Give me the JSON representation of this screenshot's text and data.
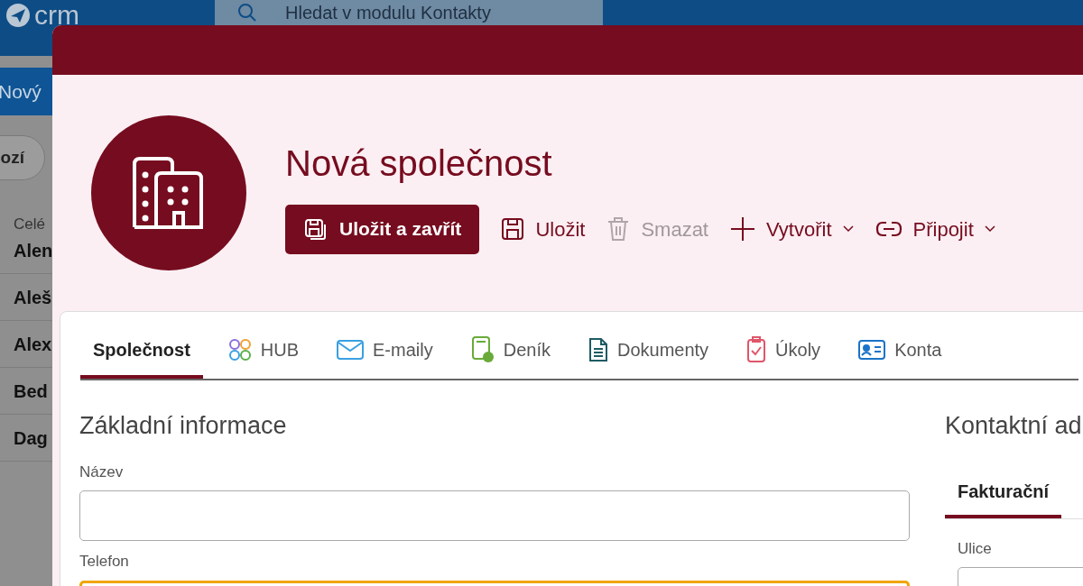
{
  "app": {
    "logo": "crm",
    "search": {
      "placeholder": "Hledat v modulu Kontakty"
    },
    "new_button": "Nový",
    "filter_button": "ozí",
    "column_header": "Celé",
    "rows": [
      "Alen",
      "Aleš",
      "Alex",
      "Bed",
      "Dag"
    ]
  },
  "dialog": {
    "title": "Nová společnost",
    "actions": [
      {
        "label": "Uložit a zavřít",
        "kind": "primary",
        "disabled": false,
        "dropdown": false
      },
      {
        "label": "Uložit",
        "kind": "plain",
        "disabled": false,
        "dropdown": false
      },
      {
        "label": "Smazat",
        "kind": "plain",
        "disabled": true,
        "dropdown": false
      },
      {
        "label": "Vytvořit",
        "kind": "plain",
        "disabled": false,
        "dropdown": true
      },
      {
        "label": "Připojit",
        "kind": "plain",
        "disabled": false,
        "dropdown": true
      }
    ],
    "tabs": [
      {
        "label": "Společnost",
        "selected": true
      },
      {
        "label": "HUB",
        "selected": false
      },
      {
        "label": "E-maily",
        "selected": false
      },
      {
        "label": "Deník",
        "selected": false
      },
      {
        "label": "Dokumenty",
        "selected": false
      },
      {
        "label": "Úkoly",
        "selected": false
      },
      {
        "label": "Konta",
        "selected": false
      }
    ],
    "basic": {
      "title": "Základní informace",
      "fields": [
        {
          "label": "Název",
          "focused": false
        },
        {
          "label": "Telefon",
          "focused": true
        }
      ]
    },
    "contact": {
      "title": "Kontaktní ad",
      "tabs": [
        {
          "label": "Fakturační",
          "selected": true
        }
      ],
      "fields": [
        {
          "label": "Ulice"
        }
      ]
    }
  }
}
